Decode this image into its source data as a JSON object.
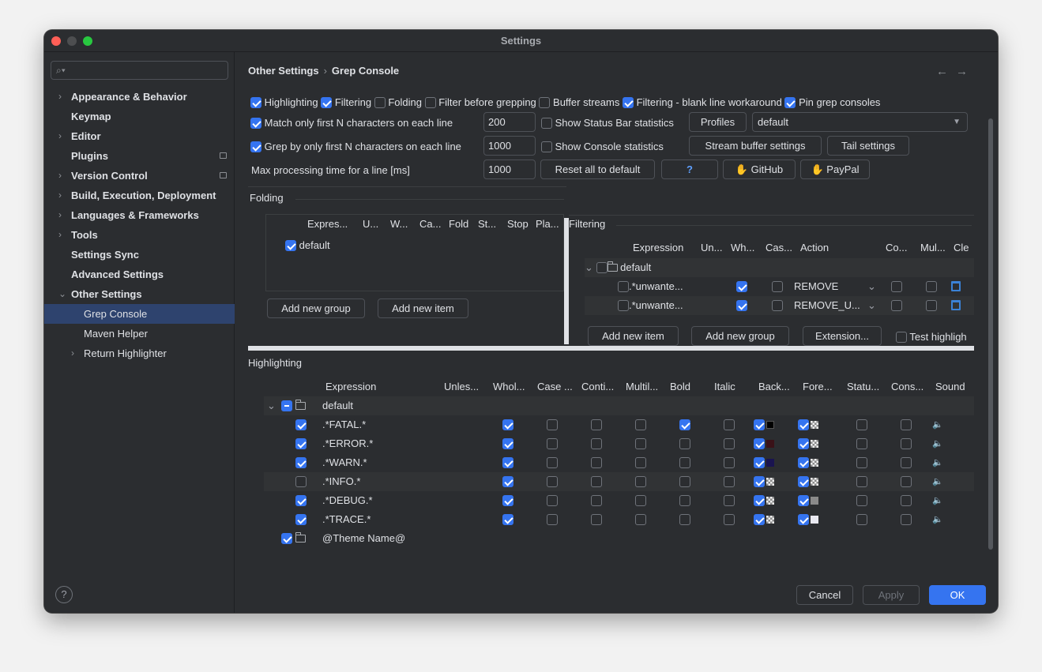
{
  "window": {
    "title": "Settings"
  },
  "search": {
    "placeholder": ""
  },
  "sidebar": {
    "items": [
      {
        "label": "Appearance & Behavior"
      },
      {
        "label": "Keymap"
      },
      {
        "label": "Editor"
      },
      {
        "label": "Plugins"
      },
      {
        "label": "Version Control"
      },
      {
        "label": "Build, Execution, Deployment"
      },
      {
        "label": "Languages & Frameworks"
      },
      {
        "label": "Tools"
      },
      {
        "label": "Settings Sync"
      },
      {
        "label": "Advanced Settings"
      },
      {
        "label": "Other Settings"
      },
      {
        "label": "Grep Console"
      },
      {
        "label": "Maven Helper"
      },
      {
        "label": "Return Highlighter"
      }
    ]
  },
  "breadcrumb": {
    "parent": "Other Settings",
    "current": "Grep Console"
  },
  "options": {
    "highlighting": "Highlighting",
    "filtering": "Filtering",
    "folding": "Folding",
    "filter_before": "Filter before grepping",
    "buffer_streams": "Buffer streams",
    "filtering_blank": "Filtering - blank line workaround",
    "pin": "Pin grep consoles",
    "match_first": "Match only first N characters on each line",
    "match_value": "200",
    "show_status": "Show Status Bar statistics",
    "profiles": "Profiles",
    "profile_value": "default",
    "grep_first": "Grep by only first N characters on each line",
    "grep_value": "1000",
    "show_console": "Show Console statistics",
    "stream_buffer": "Stream buffer settings",
    "tail": "Tail settings",
    "max_time": "Max processing time for a line [ms]",
    "max_value": "1000",
    "reset": "Reset all to default",
    "question": "?",
    "github": "GitHub",
    "paypal": "PayPal"
  },
  "folding": {
    "title": "Folding",
    "headers": [
      "Expres...",
      "U...",
      "W...",
      "Ca...",
      "Fold",
      "St...",
      "Stop",
      "Pla..."
    ],
    "row": "default",
    "add_group": "Add new group",
    "add_item": "Add new item"
  },
  "filtering": {
    "title": "Filtering",
    "headers": [
      "Expression",
      "Un...",
      "Wh...",
      "Cas...",
      "Action",
      "Co...",
      "Mul...",
      "Cle"
    ],
    "group": "default",
    "rows": [
      {
        "expr": ".*unwante...",
        "action": "REMOVE"
      },
      {
        "expr": ".*unwante...",
        "action": "REMOVE_U..."
      }
    ],
    "add_item": "Add new item",
    "add_group": "Add new group",
    "extension": "Extension...",
    "test": "Test highligh"
  },
  "highlighting": {
    "title": "Highlighting",
    "headers": [
      "Expression",
      "Unles...",
      "Whol...",
      "Case ...",
      "Conti...",
      "Multil...",
      "Bold",
      "Italic",
      "Back...",
      "Fore...",
      "Statu...",
      "Cons...",
      "Sound"
    ],
    "group": "default",
    "rows": [
      {
        "expr": ".*FATAL.*"
      },
      {
        "expr": ".*ERROR.*"
      },
      {
        "expr": ".*WARN.*"
      },
      {
        "expr": ".*INFO.*"
      },
      {
        "expr": ".*DEBUG.*"
      },
      {
        "expr": ".*TRACE.*"
      }
    ],
    "theme_group": "@Theme Name@",
    "colors": {
      "fatal_bg": "#000000",
      "error_bg": "#3a1218",
      "warn_bg": "#1a1450",
      "debug_fg": "#8a8a8a",
      "trace_fg": "#e8e8f0"
    }
  },
  "footer": {
    "cancel": "Cancel",
    "apply": "Apply",
    "ok": "OK",
    "help": "?"
  }
}
